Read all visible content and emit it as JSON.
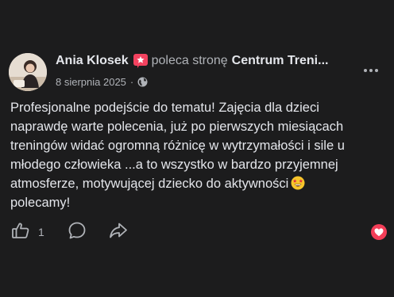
{
  "post": {
    "author": "Ania Klosek",
    "recommends_text": "poleca stronę",
    "page_name": "Centrum Treni...",
    "date": "8 sierpnia 2025",
    "separator": "·",
    "body_lines": [
      "Profesjonalne podejście do tematu! Zajęcia dla dzieci",
      "naprawdę warte polecenia, już po pierwszych miesiącach",
      "treningów widać ogromną różnicę w wytrzymałości i sile u",
      "młodego człowieka ...a to wszystko w bardzo przyjemnej",
      "atmosferze, motywującej dziecko do aktywności",
      "polecamy!"
    ]
  },
  "actions": {
    "like_count": "1"
  },
  "icons": {
    "recommend": "star-recommend-icon",
    "privacy": "globe-icon",
    "more": "more-options-icon",
    "emoji": "star-struck-emoji-icon",
    "like": "thumbs-up-icon",
    "comment": "comment-icon",
    "share": "share-icon",
    "reaction": "love-reaction-icon"
  },
  "colors": {
    "background": "#1c1c1d",
    "primary_text": "#e4e6eb",
    "secondary_text": "#b0b3b8",
    "recommend_badge": "#f3425f",
    "love_reaction": "#f33e58"
  }
}
